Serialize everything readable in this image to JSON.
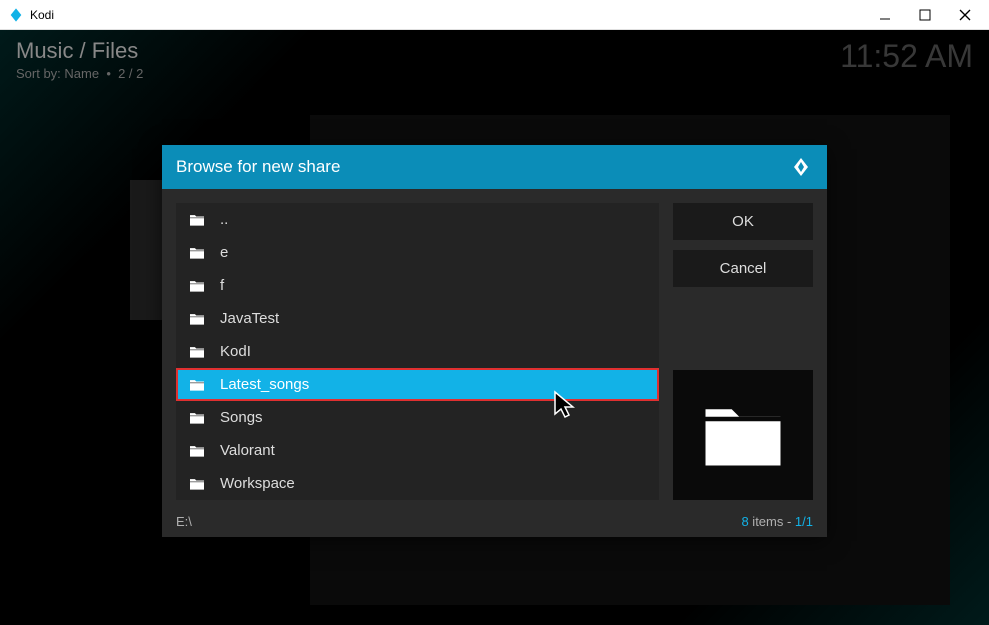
{
  "titlebar": {
    "app_name": "Kodi"
  },
  "header": {
    "breadcrumb": "Music / Files",
    "sort_label": "Sort by: Name",
    "counter": "2 / 2",
    "clock": "11:52 AM"
  },
  "dialog": {
    "title": "Browse for new share",
    "items": [
      {
        "label": ".."
      },
      {
        "label": "e"
      },
      {
        "label": "f"
      },
      {
        "label": "JavaTest"
      },
      {
        "label": "KodI"
      },
      {
        "label": "Latest_songs"
      },
      {
        "label": "Songs"
      },
      {
        "label": "Valorant"
      },
      {
        "label": "Workspace"
      }
    ],
    "selected_index": 5,
    "buttons": {
      "ok": "OK",
      "cancel": "Cancel"
    },
    "footer": {
      "path": "E:\\",
      "count_num": "8",
      "count_label": " items - ",
      "page": "1/1"
    }
  }
}
